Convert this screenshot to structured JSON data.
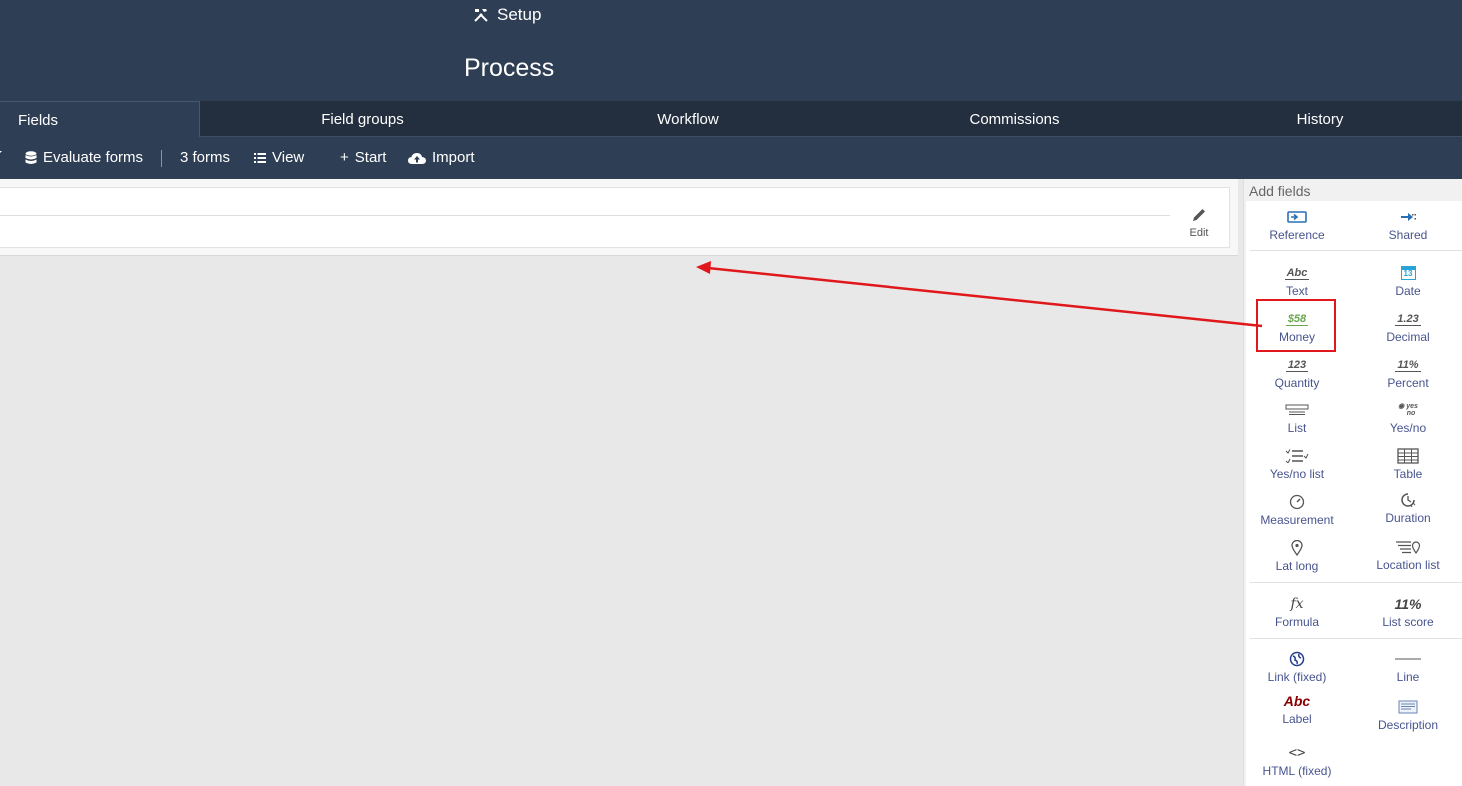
{
  "header": {
    "setup_label": "Setup",
    "title": "Process"
  },
  "tabs": [
    {
      "label": "Fields"
    },
    {
      "label": "Field groups"
    },
    {
      "label": "Workflow"
    },
    {
      "label": "Commissions"
    },
    {
      "label": "History"
    }
  ],
  "toolbar": {
    "evaluate_label": "Evaluate forms",
    "forms_count": "3 forms",
    "view_label": "View",
    "start_label": "Start",
    "import_label": "Import"
  },
  "panel": {
    "edit_label": "Edit"
  },
  "sidebar": {
    "title": "Add fields",
    "fields": [
      {
        "label": "Reference",
        "icon": "reference-icon"
      },
      {
        "label": "Shared",
        "icon": "shared-icon"
      },
      {
        "label": "Text",
        "icon": "text-icon",
        "glyph": "Abc"
      },
      {
        "label": "Date",
        "icon": "date-icon",
        "glyph": "13"
      },
      {
        "label": "Money",
        "icon": "money-icon",
        "glyph": "$58"
      },
      {
        "label": "Decimal",
        "icon": "decimal-icon",
        "glyph": "1.23"
      },
      {
        "label": "Quantity",
        "icon": "quantity-icon",
        "glyph": "123"
      },
      {
        "label": "Percent",
        "icon": "percent-icon",
        "glyph": "11%"
      },
      {
        "label": "List",
        "icon": "list-icon"
      },
      {
        "label": "Yes/no",
        "icon": "yes-no-icon",
        "glyph_top": "yes",
        "glyph_bottom": "no"
      },
      {
        "label": "Yes/no list",
        "icon": "yes-no-list-icon"
      },
      {
        "label": "Table",
        "icon": "table-icon"
      },
      {
        "label": "Measurement",
        "icon": "measurement-icon"
      },
      {
        "label": "Duration",
        "icon": "duration-icon"
      },
      {
        "label": "Lat long",
        "icon": "map-pin-icon"
      },
      {
        "label": "Location list",
        "icon": "location-list-icon"
      },
      {
        "label": "Formula",
        "icon": "formula-icon",
        "glyph": "fx"
      },
      {
        "label": "List score",
        "icon": "list-score-icon",
        "glyph": "11%"
      },
      {
        "label": "Link (fixed)",
        "icon": "globe-link-icon"
      },
      {
        "label": "Line",
        "icon": "line-icon"
      },
      {
        "label": "Label",
        "icon": "label-icon",
        "glyph": "Abc"
      },
      {
        "label": "Description",
        "icon": "description-icon"
      },
      {
        "label": "HTML (fixed)",
        "icon": "code-icon",
        "glyph": "<>"
      }
    ]
  },
  "colors": {
    "header_bg": "#2e3e54",
    "tabs_bg": "#232e3f",
    "link": "#48548f",
    "highlight": "#e0181b",
    "money_green": "#6aa84f",
    "label_red": "#8b0000"
  }
}
